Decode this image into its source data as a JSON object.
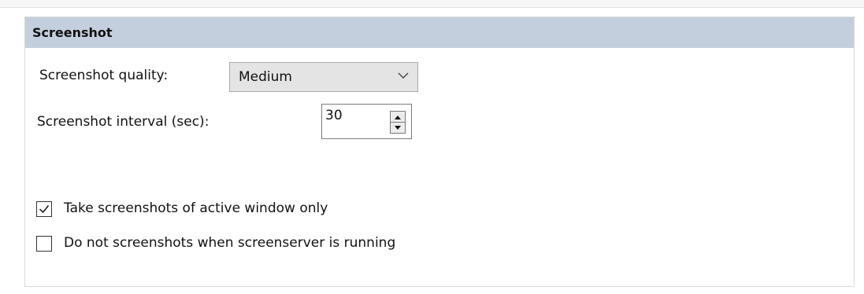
{
  "panel": {
    "title": "Screenshot"
  },
  "quality": {
    "label": "Screenshot quality:",
    "value": "Medium"
  },
  "interval": {
    "label": "Screenshot interval (sec):",
    "value": "30"
  },
  "options": [
    {
      "label": "Take screenshots of active window only",
      "checked": true
    },
    {
      "label": "Do not screenshots when screenserver is running",
      "checked": false
    }
  ],
  "colors": {
    "header_bg": "#c3cfdd",
    "combo_bg": "#e4e4e4"
  },
  "icons": {
    "combo": "chevron-down-icon",
    "spin_up": "caret-up-icon",
    "spin_down": "caret-down-icon",
    "check": "checkmark-icon"
  }
}
